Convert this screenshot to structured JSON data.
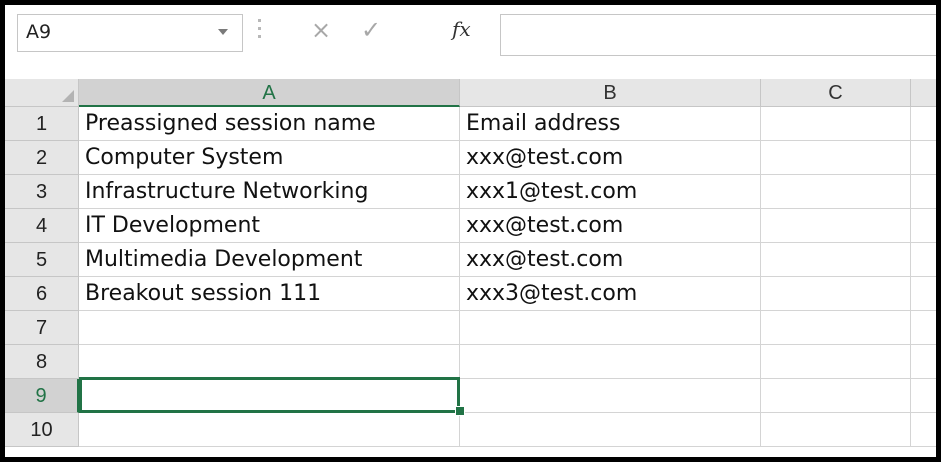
{
  "formula_bar": {
    "name_box": "A9",
    "cancel_icon": "×",
    "enter_icon": "✓",
    "function_icon": "fx",
    "formula": ""
  },
  "columns": [
    "A",
    "B",
    "C"
  ],
  "selected_column": "A",
  "rows": [
    {
      "num": "1",
      "a": "Preassigned session name",
      "b": "Email address",
      "c": ""
    },
    {
      "num": "2",
      "a": "Computer System",
      "b": "xxx@test.com",
      "c": ""
    },
    {
      "num": "3",
      "a": "Infrastructure Networking",
      "b": "xxx1@test.com",
      "c": ""
    },
    {
      "num": "4",
      "a": "IT Development",
      "b": "xxx@test.com",
      "c": ""
    },
    {
      "num": "5",
      "a": "Multimedia Development",
      "b": "xxx@test.com",
      "c": ""
    },
    {
      "num": "6",
      "a": "Breakout session 111",
      "b": "xxx3@test.com",
      "c": ""
    },
    {
      "num": "7",
      "a": "",
      "b": "",
      "c": ""
    },
    {
      "num": "8",
      "a": "",
      "b": "",
      "c": ""
    },
    {
      "num": "9",
      "a": "",
      "b": "",
      "c": ""
    },
    {
      "num": "10",
      "a": "",
      "b": "",
      "c": ""
    }
  ],
  "selected_row": "9",
  "colors": {
    "accent": "#217346",
    "header_bg": "#e6e6e6",
    "gridline": "#d4d4d4"
  }
}
